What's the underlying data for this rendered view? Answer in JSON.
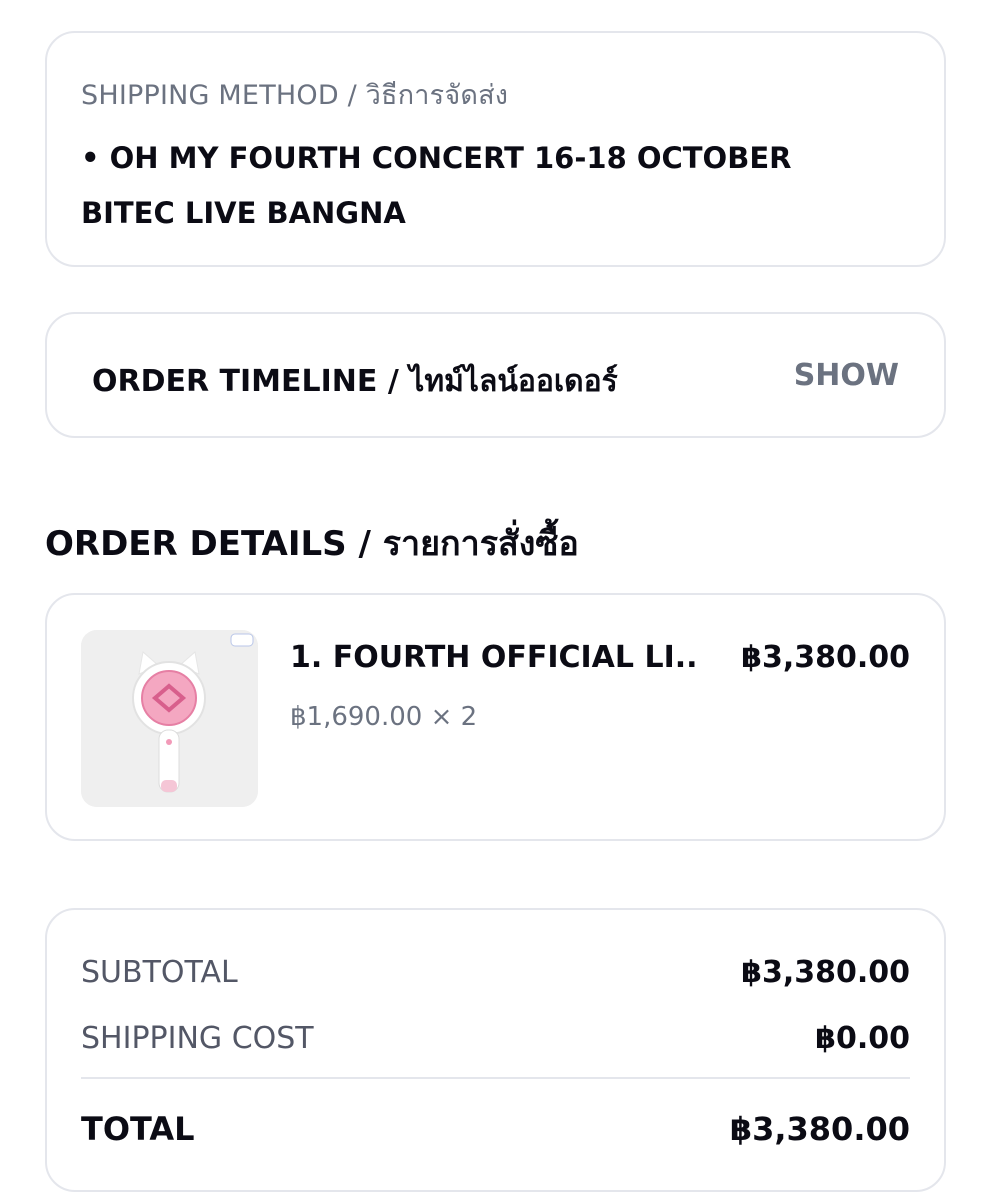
{
  "shipping": {
    "label": "SHIPPING METHOD / วิธีการจัดส่ง",
    "value": "• OH MY FOURTH CONCERT 16-18 OCTOBER BITEC LIVE BANGNA"
  },
  "timeline": {
    "title": "ORDER TIMELINE / ไทม์ไลน์ออเดอร์",
    "toggle_label": "SHOW"
  },
  "order_details": {
    "title": "ORDER DETAILS / รายการสั่งซื้อ",
    "items": [
      {
        "name": "1. FOURTH OFFICIAL LI...",
        "price": "฿3,380.00",
        "unit_qty": "฿1,690.00 × 2",
        "image_icon": "lightstick-image"
      }
    ]
  },
  "summary": {
    "subtotal_label": "SUBTOTAL",
    "subtotal_value": "฿3,380.00",
    "shipping_label": "SHIPPING COST",
    "shipping_value": "฿0.00",
    "total_label": "TOTAL",
    "total_value": "฿3,380.00"
  },
  "colors": {
    "text_primary": "#0b0b14",
    "text_secondary": "#6b7280",
    "border": "#e4e6ec",
    "accent_pink": "#f29ab8"
  }
}
